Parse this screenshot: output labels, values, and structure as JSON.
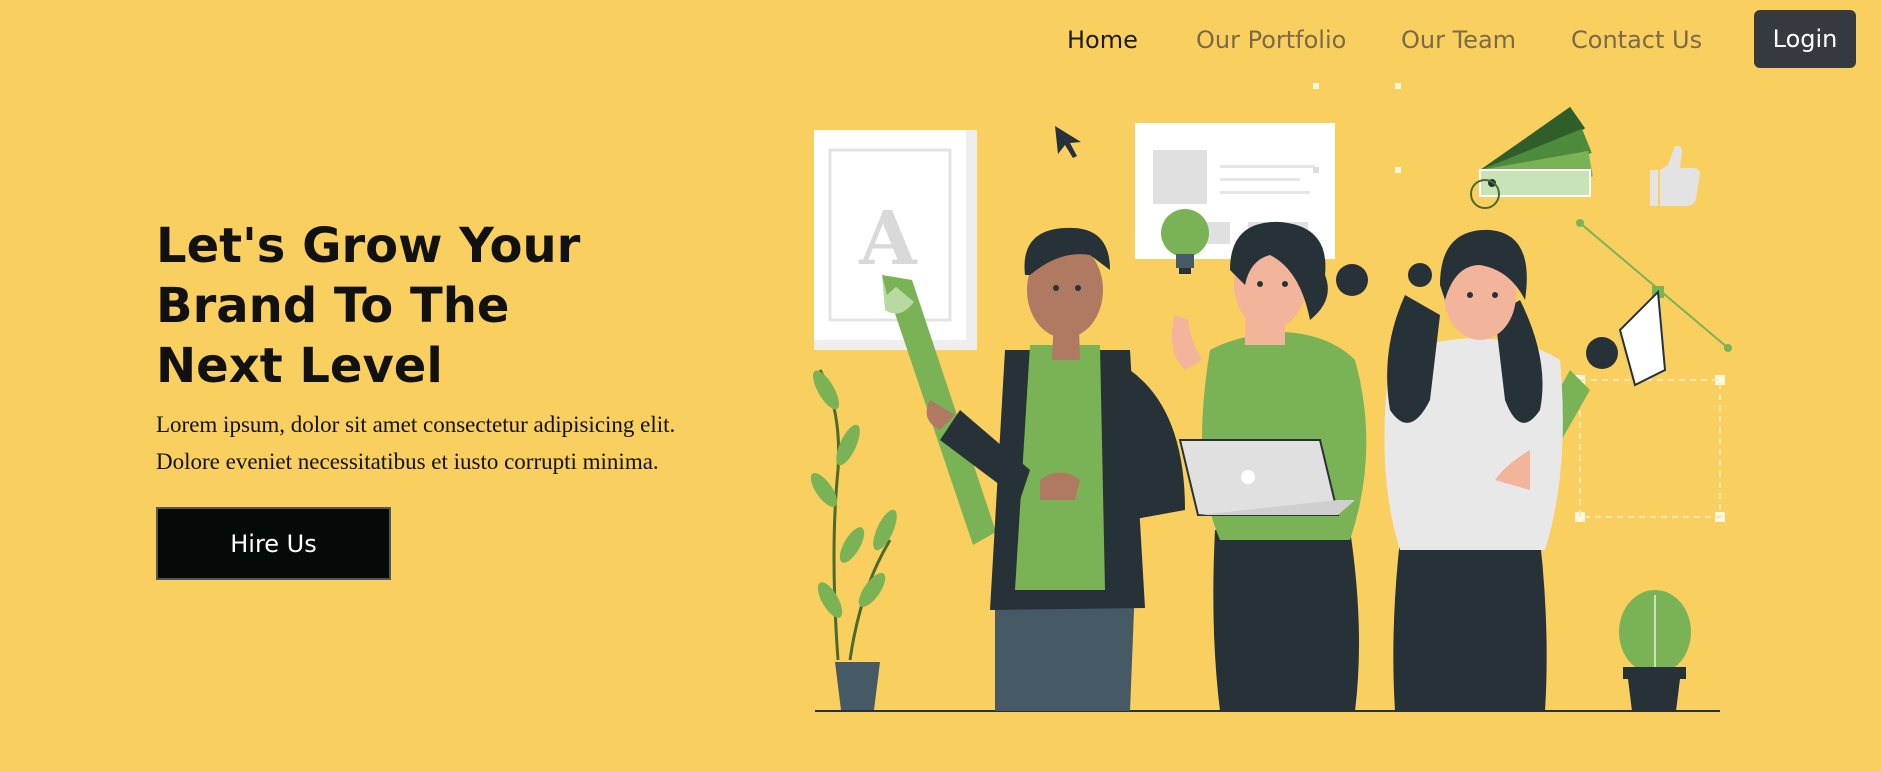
{
  "nav": {
    "items": [
      {
        "label": "Home",
        "active": true
      },
      {
        "label": "Our Portfolio",
        "active": false
      },
      {
        "label": "Our Team",
        "active": false
      },
      {
        "label": "Contact Us",
        "active": false
      }
    ],
    "login_label": "Login"
  },
  "hero": {
    "title_lines": [
      "Let's Grow Your",
      "Brand To The",
      "Next Level"
    ],
    "description_lines": [
      "Lorem ipsum, dolor sit amet consectetur adipisicing elit.",
      "Dolore eveniet necessitatibus et iusto corrupti minima."
    ],
    "cta_label": "Hire Us",
    "illustration_letter": "A"
  },
  "colors": {
    "background": "#f9cf5f",
    "accent_green": "#7ab356",
    "dark": "#263238",
    "login_bg": "#343a40",
    "cta_bg": "#040a08"
  },
  "icons": [
    "cursor-icon",
    "lightbulb-icon",
    "thumbs-up-icon",
    "color-swatch-icon",
    "pen-tool-icon"
  ]
}
